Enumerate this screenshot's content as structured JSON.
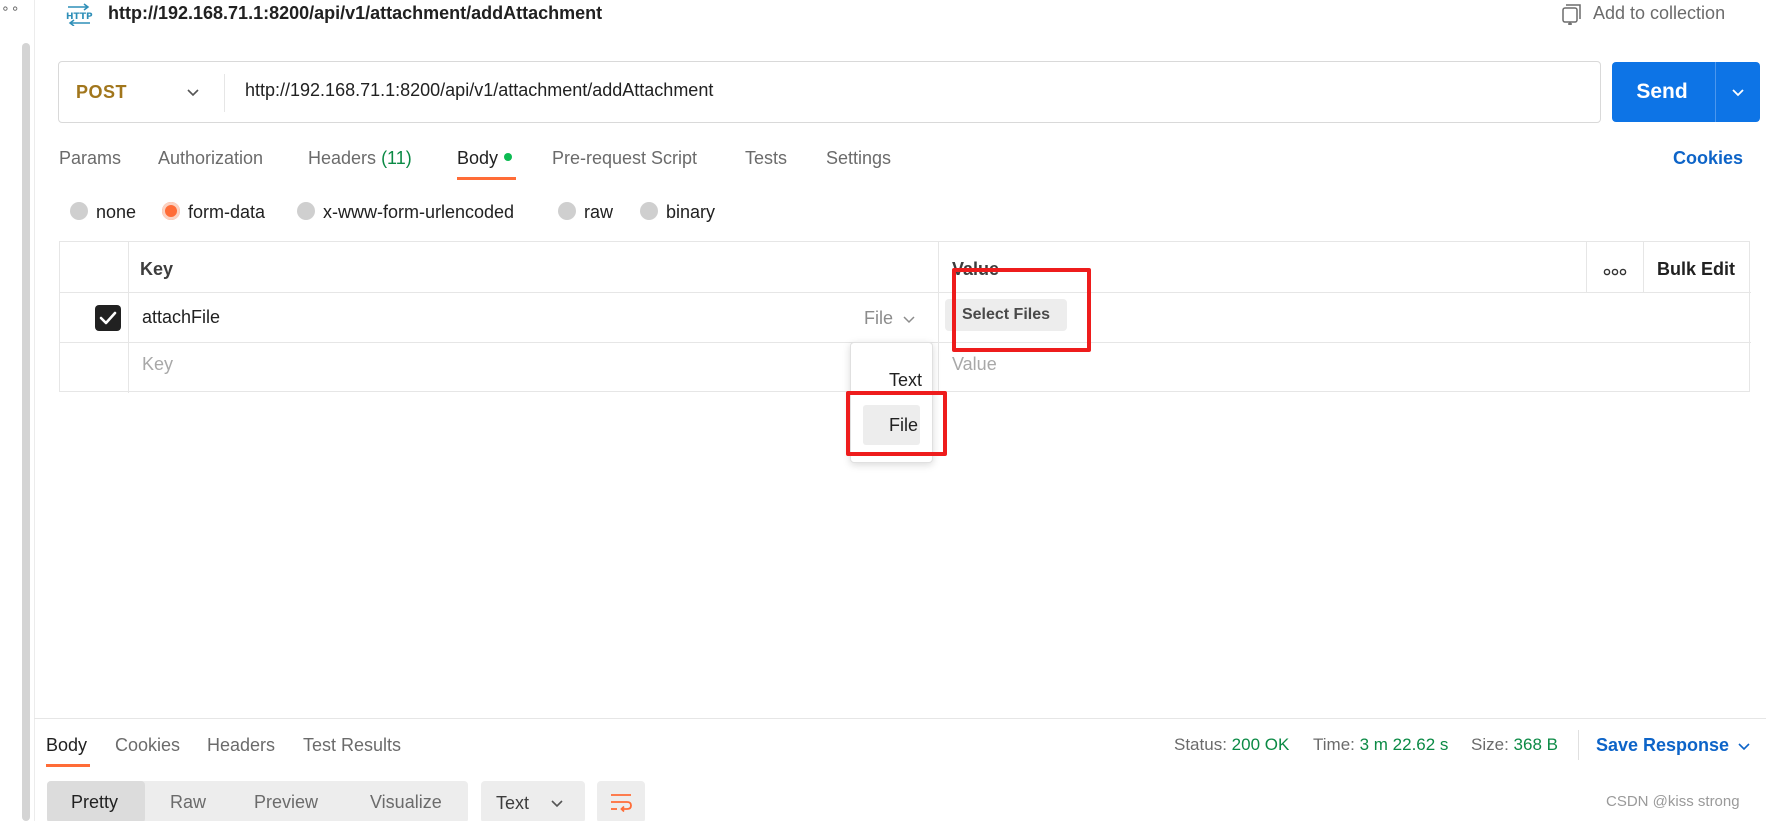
{
  "header": {
    "title": "http://192.168.71.1:8200/api/v1/attachment/addAttachment",
    "add_to_collection": "Add to collection",
    "protocol_icon": "http-icon"
  },
  "request": {
    "method": "POST",
    "url": "http://192.168.71.1:8200/api/v1/attachment/addAttachment",
    "send_label": "Send"
  },
  "tabs": {
    "params": "Params",
    "authorization": "Authorization",
    "headers": "Headers",
    "headers_count": "(11)",
    "body": "Body",
    "pre_request": "Pre-request Script",
    "tests": "Tests",
    "settings": "Settings",
    "cookies": "Cookies",
    "active": "Body"
  },
  "body_types": {
    "none": "none",
    "form_data": "form-data",
    "urlencoded": "x-www-form-urlencoded",
    "raw": "raw",
    "binary": "binary",
    "selected": "form-data"
  },
  "form_table": {
    "key_header": "Key",
    "value_header": "Value",
    "bulk_edit": "Bulk Edit",
    "rows": [
      {
        "checked": true,
        "key": "attachFile",
        "type": "File",
        "value_button": "Select Files"
      }
    ],
    "key_placeholder": "Key",
    "value_placeholder": "Value"
  },
  "type_dropdown": {
    "options": [
      "Text",
      "File"
    ],
    "highlighted": "File"
  },
  "response": {
    "tabs": {
      "body": "Body",
      "cookies": "Cookies",
      "headers": "Headers",
      "test_results": "Test Results"
    },
    "status_label": "Status:",
    "status_value": "200 OK",
    "time_label": "Time:",
    "time_value": "3 m 22.62 s",
    "size_label": "Size:",
    "size_value": "368 B",
    "save_response": "Save Response",
    "views": {
      "pretty": "Pretty",
      "raw": "Raw",
      "preview": "Preview",
      "visualize": "Visualize"
    },
    "format": "Text"
  },
  "watermark": "CSDN @kiss strong",
  "colors": {
    "accent_orange": "#ff6c37",
    "send_blue": "#0d74e6",
    "link_blue": "#0d64c8",
    "success_green": "#0b8a45",
    "method_post": "#a1761c",
    "annotation_red": "#ee1c1c"
  }
}
